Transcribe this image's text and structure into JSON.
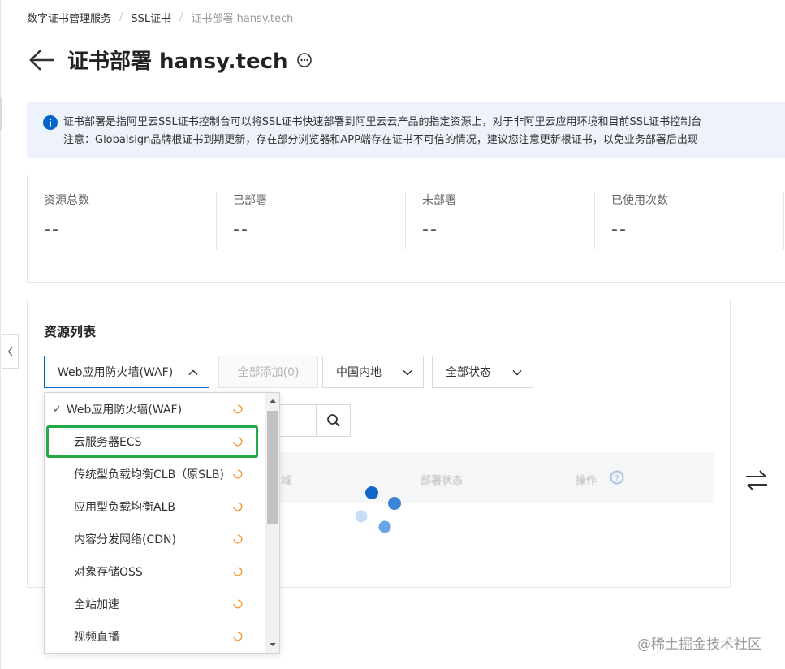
{
  "breadcrumb": {
    "item1": "数字证书管理服务",
    "item2": "SSL证书",
    "current": "证书部署 hansy.tech"
  },
  "header": {
    "title": "证书部署 hansy.tech"
  },
  "notice": {
    "line1": "证书部署是指阿里云SSL证书控制台可以将SSL证书快速部署到阿里云云产品的指定资源上，对于非阿里云应用环境和目前SSL证书控制台",
    "line2": "注意：Globalsign品牌根证书到期更新，存在部分浏览器和APP端存在证书不可信的情况，建议您注意更新根证书，以免业务部署后出现"
  },
  "stats": [
    {
      "label": "资源总数",
      "value": "--"
    },
    {
      "label": "已部署",
      "value": "--"
    },
    {
      "label": "未部署",
      "value": "--"
    },
    {
      "label": "已使用次数",
      "value": "--"
    }
  ],
  "resource_list": {
    "title": "资源列表",
    "product_select": "Web应用防火墙(WAF)",
    "add_all": "全部添加(0)",
    "region_select": "中国内地",
    "status_select": "全部状态",
    "table_headers": {
      "col1": "域",
      "col2": "部署状态",
      "col3": "操作"
    }
  },
  "dropdown": {
    "items": [
      "Web应用防火墙(WAF)",
      "云服务器ECS",
      "传统型负载均衡CLB（原SLB)",
      "应用型负载均衡ALB",
      "内容分发网络(CDN)",
      "对象存储OSS",
      "全站加速",
      "视频直播"
    ]
  },
  "watermark": "@稀土掘金技术社区",
  "colors": {
    "accent": "#0064c8",
    "highlight": "#27a844",
    "spinner": "#f39c3c"
  }
}
